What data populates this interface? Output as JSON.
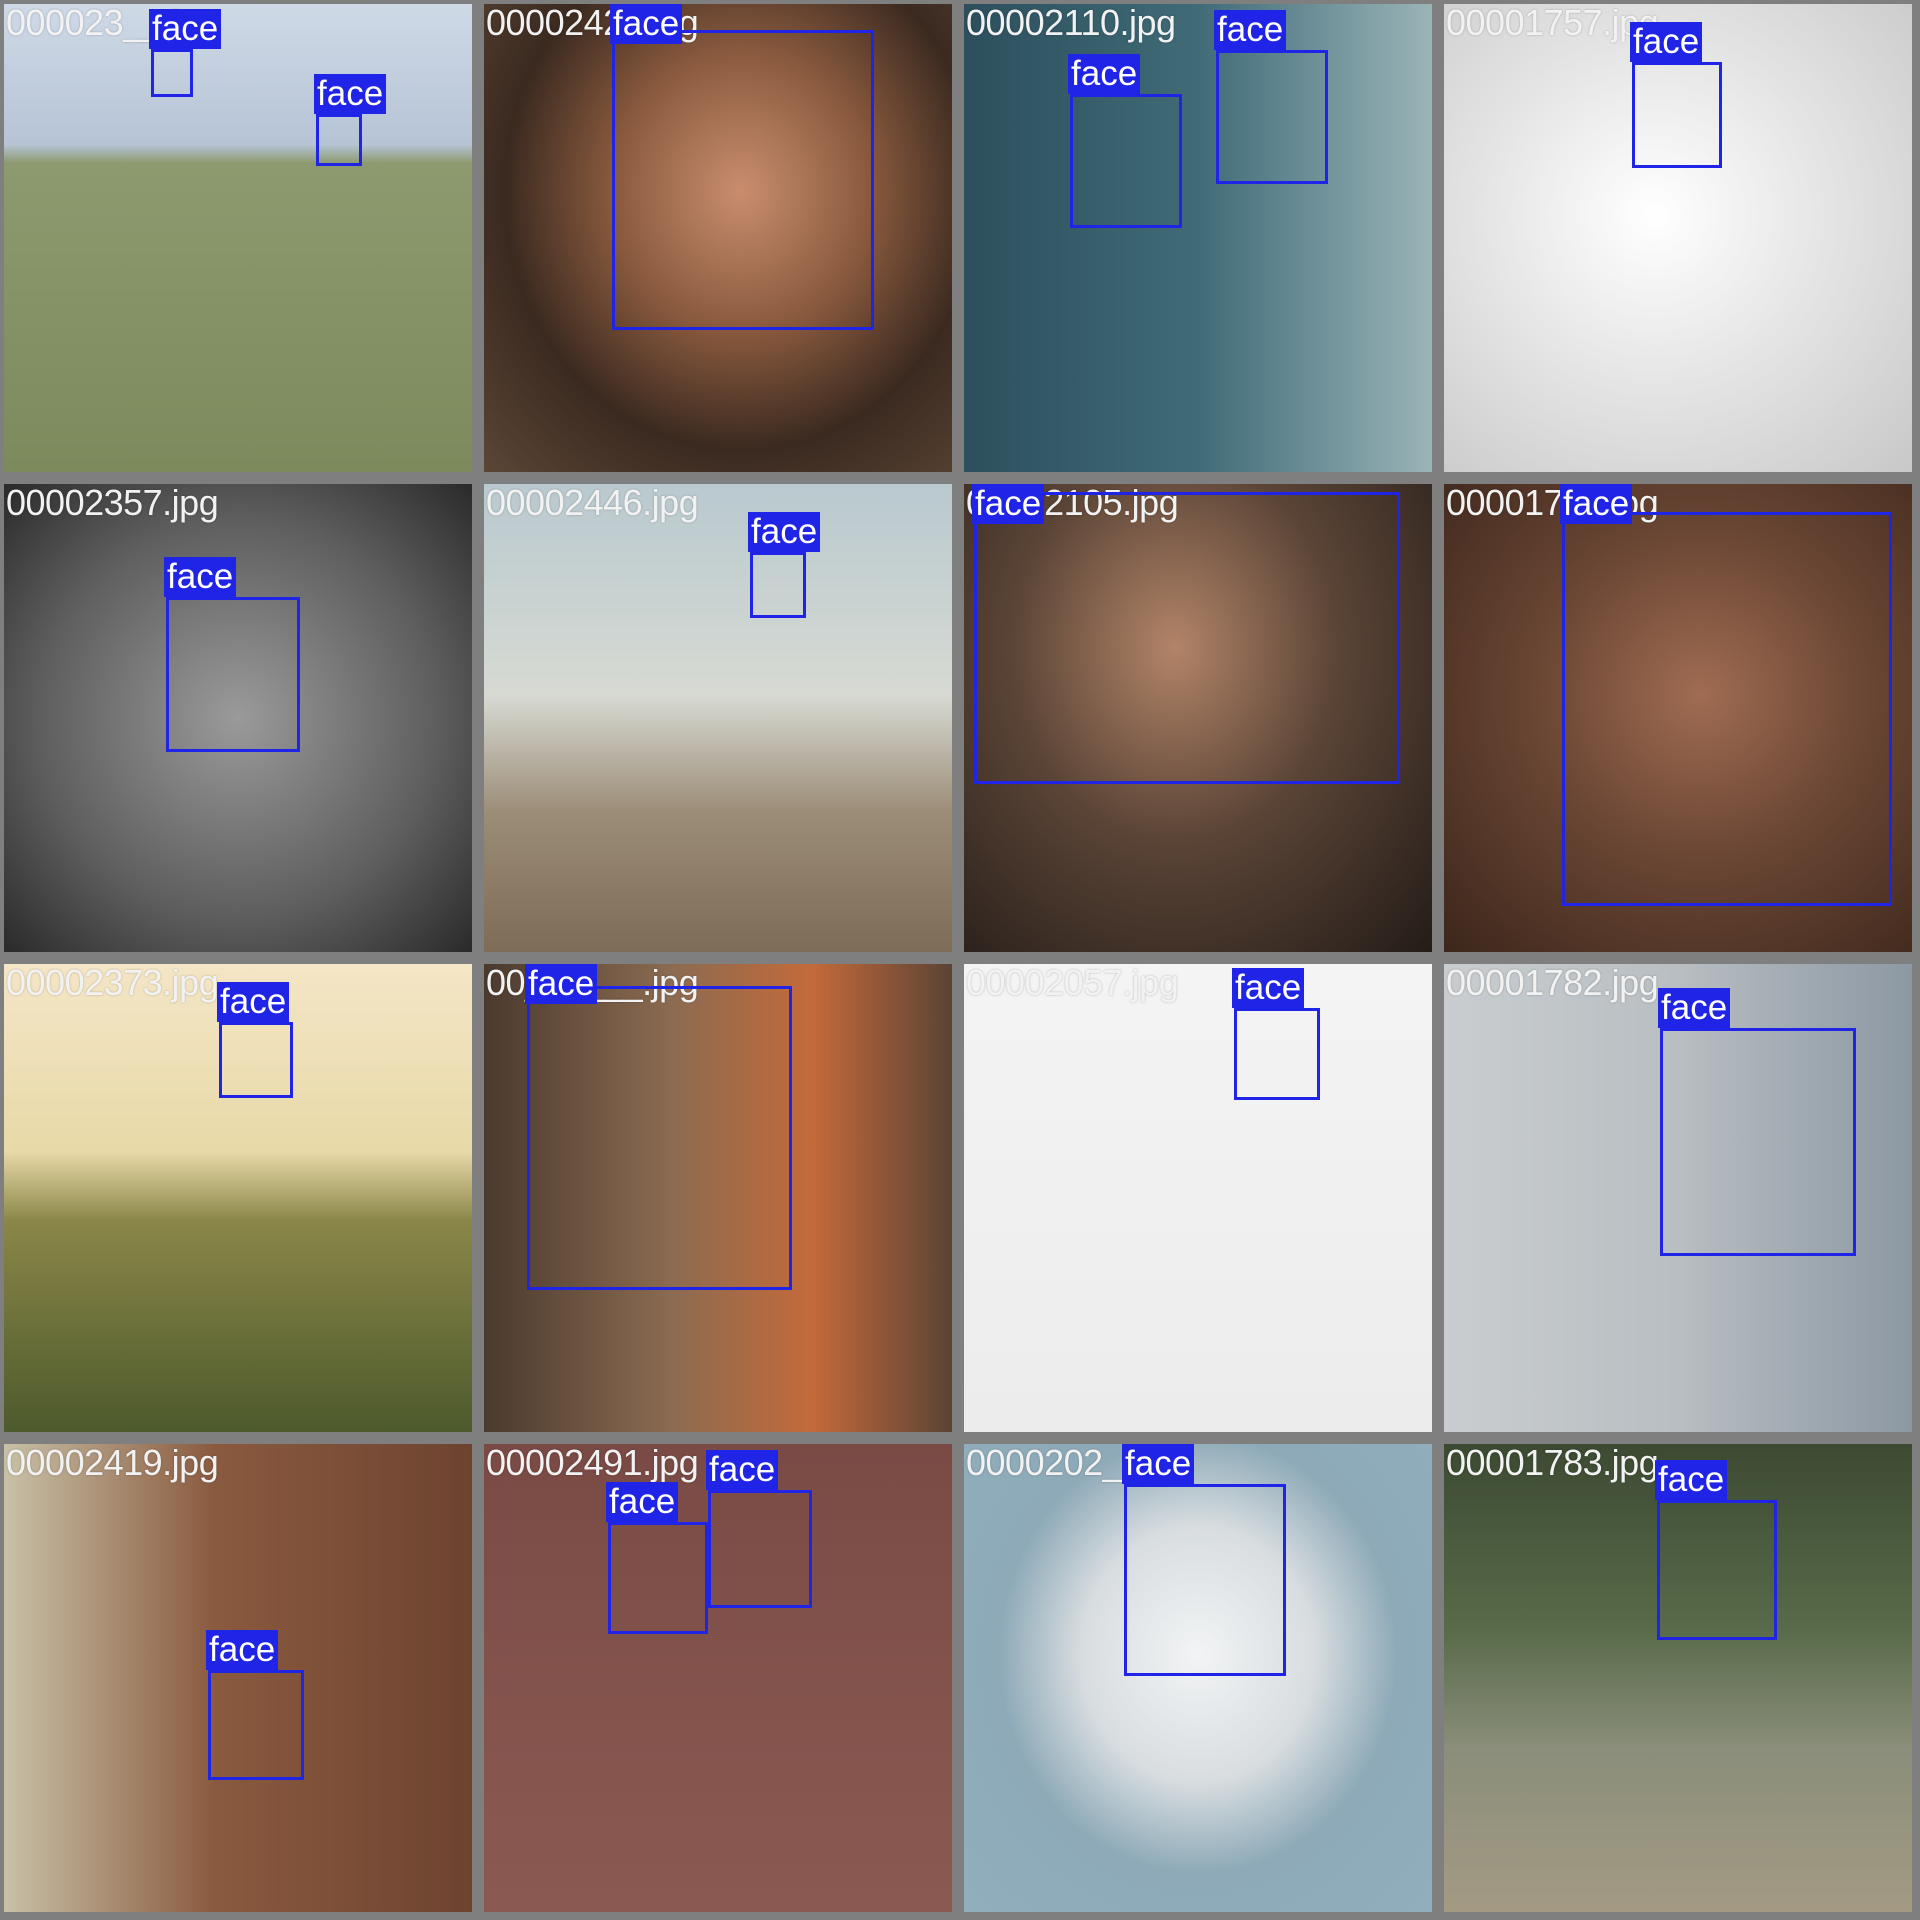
{
  "colors": {
    "box": "#1f24e6",
    "label_bg": "#1f24e6",
    "label_text": "#ffffff",
    "filename_text": "#f2f2f2",
    "grid_border": "#7f7f7f"
  },
  "class_label": "face",
  "tiles": [
    {
      "filename": "000023__.jpg"
    },
    {
      "filename": "00002420.jpg"
    },
    {
      "filename": "00002110.jpg"
    },
    {
      "filename": "00001757.jpg"
    },
    {
      "filename": "00002357.jpg"
    },
    {
      "filename": "00002446.jpg"
    },
    {
      "filename": "00002105.jpg"
    },
    {
      "filename": "000017__.jpg"
    },
    {
      "filename": "00002373.jpg"
    },
    {
      "filename": "00______.jpg"
    },
    {
      "filename": "00002057.jpg"
    },
    {
      "filename": "00001782.jpg"
    },
    {
      "filename": "00002419.jpg"
    },
    {
      "filename": "00002491.jpg"
    },
    {
      "filename": "0000202_.jpg"
    },
    {
      "filename": "00001783.jpg"
    }
  ]
}
